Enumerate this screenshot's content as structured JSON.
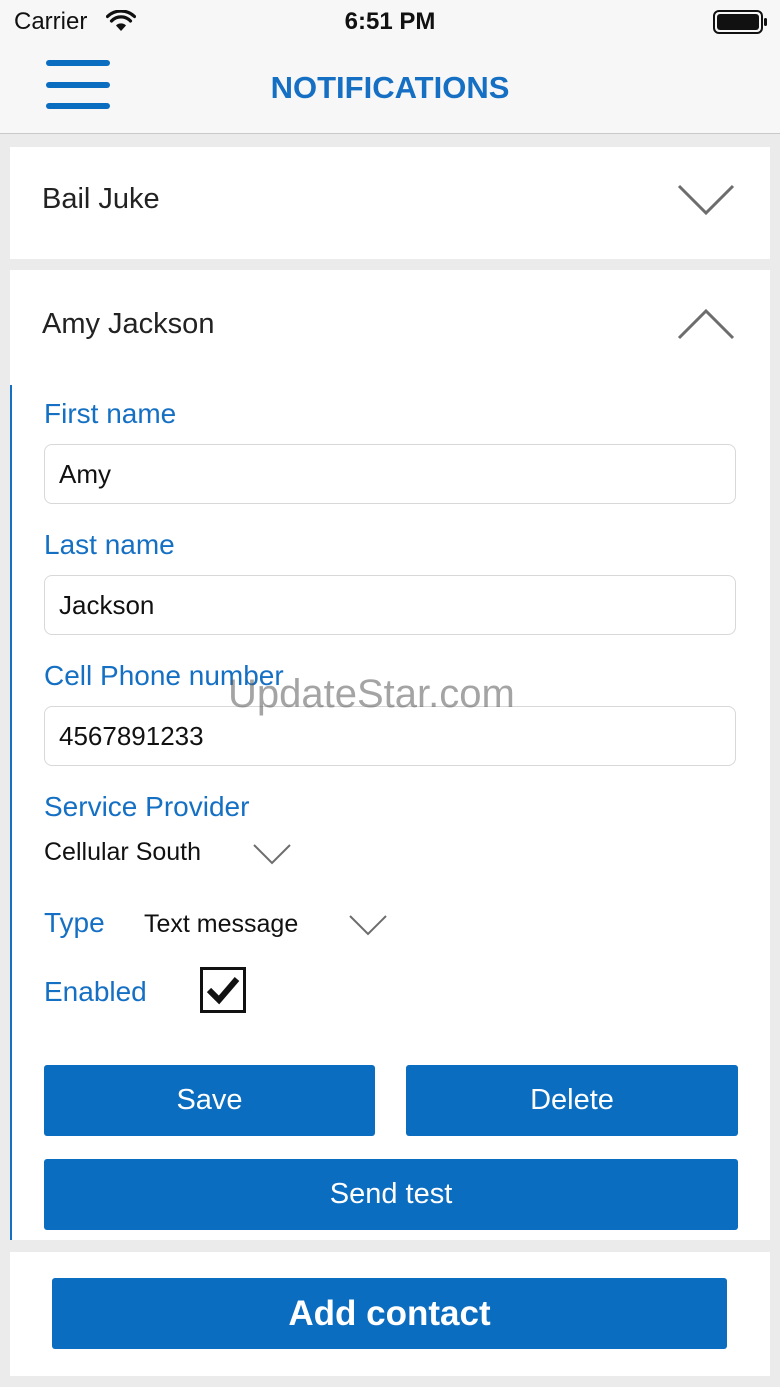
{
  "status_bar": {
    "carrier": "Carrier",
    "time": "6:51 PM",
    "icons": [
      "wifi-icon",
      "battery-icon"
    ]
  },
  "nav": {
    "title": "NOTIFICATIONS",
    "menu_icon": "hamburger-menu-icon"
  },
  "contacts": [
    {
      "name": "Bail Juke",
      "expanded": false,
      "toggle_icon": "chevron-down-icon"
    },
    {
      "name": "Amy Jackson",
      "expanded": true,
      "toggle_icon": "chevron-up-icon"
    }
  ],
  "form": {
    "first_name_label": "First name",
    "first_name_value": "Amy",
    "last_name_label": "Last name",
    "last_name_value": "Jackson",
    "phone_label": "Cell Phone number",
    "phone_value": "4567891233",
    "provider_label": "Service Provider",
    "provider_value": "Cellular South",
    "type_label": "Type",
    "type_value": "Text message",
    "enabled_label": "Enabled",
    "enabled_checked": true
  },
  "buttons": {
    "save": "Save",
    "delete": "Delete",
    "send_test": "Send test",
    "add_contact": "Add contact"
  },
  "watermark": "UpdateStar.com",
  "colors": {
    "accent": "#1570c4",
    "button": "#0a6dc0",
    "background": "#ebebeb"
  }
}
